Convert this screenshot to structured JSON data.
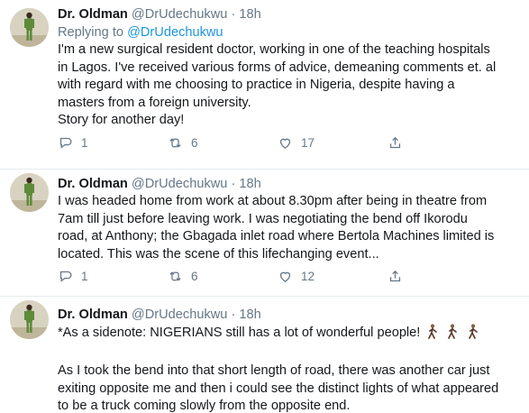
{
  "tweets": [
    {
      "author_name": "Dr. Oldman",
      "author_handle": "@DrUdechukwu",
      "separator": "·",
      "time": "18h",
      "replying_prefix": "Replying to",
      "replying_to": "@DrUdechukwu",
      "lines": [
        "I'm a new surgical resident doctor, working in one of the teaching hospitals",
        "in Lagos. I've received various forms of advice, demeaning comments et. al",
        "with regard with me choosing to practice in Nigeria, despite having a",
        "masters from a foreign university.",
        "Story for another day!"
      ],
      "reply_count": "1",
      "retweet_count": "6",
      "like_count": "17"
    },
    {
      "author_name": "Dr. Oldman",
      "author_handle": "@DrUdechukwu",
      "separator": "·",
      "time": "18h",
      "lines": [
        "I was headed home from work at about 8.30pm after being in theatre from",
        "7am till just before leaving work. I was negotiating the bend off Ikorodu",
        "road, at Anthony; the Gbagada inlet road where Bertola Machines limited is",
        "located. This was the scene of this lifechanging event..."
      ],
      "reply_count": "1",
      "retweet_count": "6",
      "like_count": "12"
    },
    {
      "author_name": "Dr. Oldman",
      "author_handle": "@DrUdechukwu",
      "separator": "·",
      "time": "18h",
      "first_line": "*As a sidenote: NIGERIANS still has a lot of wonderful people!",
      "lines": [
        "As I took the bend into that short length of road, there was another car just",
        "exiting opposite me and then i could see the distinct lights of what appeared",
        "to be a truck coming slowly from the opposite end."
      ]
    }
  ],
  "icons": {
    "reply": "reply-icon",
    "retweet": "retweet-icon",
    "like": "heart-icon",
    "share": "share-icon",
    "emoji": "person-walking-emoji"
  },
  "colors": {
    "link": "#1b95e0",
    "secondary_text": "#657786",
    "divider": "#e6ecf0"
  }
}
